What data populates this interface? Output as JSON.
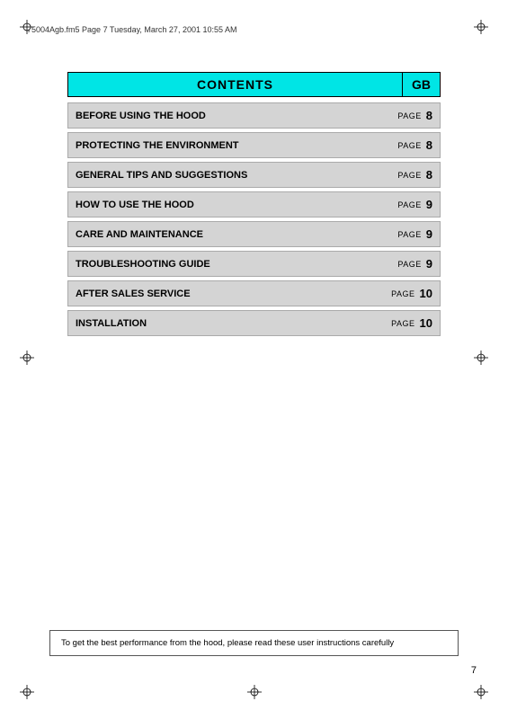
{
  "header": {
    "file_info": "75004Agb.fm5  Page 7  Tuesday, March 27, 2001  10:55 AM"
  },
  "contents": {
    "title": "CONTENTS",
    "gb_label": "GB",
    "rows": [
      {
        "label": "BEFORE USING THE HOOD",
        "page_word": "PAGE",
        "page_num": "8"
      },
      {
        "label": "PROTECTING THE ENVIRONMENT",
        "page_word": "PAGE",
        "page_num": "8"
      },
      {
        "label": "GENERAL TIPS AND SUGGESTIONS",
        "page_word": "PAGE",
        "page_num": "8"
      },
      {
        "label": "HOW TO USE THE HOOD",
        "page_word": "PAGE",
        "page_num": "9"
      },
      {
        "label": "CARE AND MAINTENANCE",
        "page_word": "PAGE",
        "page_num": "9"
      },
      {
        "label": "TROUBLESHOOTING GUIDE",
        "page_word": "PAGE",
        "page_num": "9"
      },
      {
        "label": "AFTER SALES SERVICE",
        "page_word": "PAGE",
        "page_num": "10"
      },
      {
        "label": "INSTALLATION",
        "page_word": "PAGE",
        "page_num": "10"
      }
    ]
  },
  "bottom_note": "To get the best performance from the hood, please read these user instructions carefully",
  "page_number": "7"
}
